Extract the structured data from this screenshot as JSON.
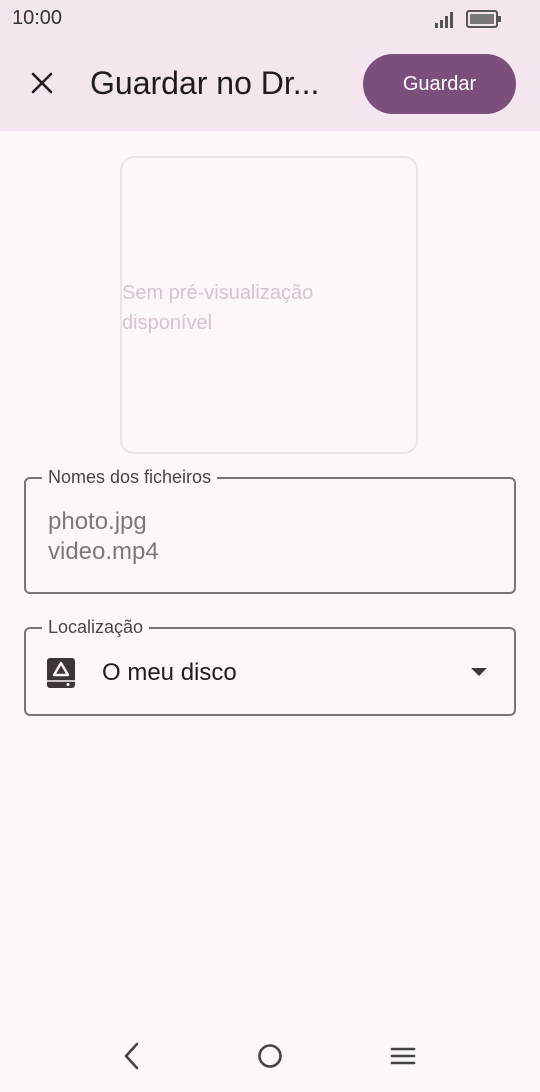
{
  "status_bar": {
    "time": "10:00"
  },
  "app_bar": {
    "title": "Guardar no Dr...",
    "save_label": "Guardar"
  },
  "preview": {
    "text_line1": "Sem pré-visualização",
    "text_line2": "disponível"
  },
  "filenames": {
    "label": "Nomes dos ficheiros",
    "files": [
      "photo.jpg",
      "video.mp4"
    ]
  },
  "location": {
    "label": "Localização",
    "value": "O meu disco"
  },
  "colors": {
    "accent": "#7c4e7c",
    "topbar": "#f3e6ee",
    "background": "#fdf7f9"
  }
}
